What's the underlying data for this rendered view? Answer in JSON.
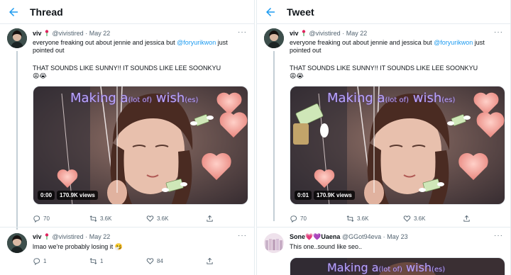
{
  "left": {
    "header_title": "Thread",
    "tweets": [
      {
        "name": "viv",
        "handle": "@vivistired",
        "sep": "·",
        "date": "May 22",
        "text_pre": "everyone freaking out about jennie and jessica but ",
        "mention": "@foryurikwon",
        "text_post": " just pointed out",
        "line2": "THAT SOUNDS LIKE SUNNY!! IT SOUNDS LIKE LEE SOONKYU",
        "emoji": "😩😭",
        "media": {
          "overlay_a": "Making a",
          "overlay_small": "(lot of)",
          "overlay_b": " wish",
          "overlay_small2": "(es)",
          "time": "0:00",
          "views": "170.9K views"
        },
        "stats": {
          "replies": "70",
          "retweets": "3.6K",
          "likes": "3.6K"
        }
      },
      {
        "name": "viv",
        "handle": "@vivistired",
        "sep": "·",
        "date": "May 22",
        "text": "lmao we're probably losing it 🤧",
        "stats": {
          "replies": "1",
          "retweets": "1",
          "likes": "84"
        }
      }
    ]
  },
  "right": {
    "header_title": "Tweet",
    "tweets": [
      {
        "name": "viv",
        "handle": "@vivistired",
        "sep": "·",
        "date": "May 22",
        "text_pre": "everyone freaking out about jennie and jessica but ",
        "mention": "@foryurikwon",
        "text_post": " just pointed out",
        "line2": "THAT SOUNDS LIKE SUNNY!! IT SOUNDS LIKE LEE SOONKYU",
        "emoji": "😩😭",
        "media": {
          "overlay_a": "Making a",
          "overlay_small": "(lot of)",
          "overlay_b": " wish",
          "overlay_small2": "(es)",
          "time": "0:01",
          "views": "170.9K views"
        },
        "stats": {
          "replies": "70",
          "retweets": "3.6K",
          "likes": "3.6K"
        }
      },
      {
        "name": "Sone💗💜Uaena",
        "handle": "@GGot94eva",
        "sep": "·",
        "date": "May 23",
        "text": "This one..sound like seo..",
        "media": {
          "overlay_a": "Making a",
          "overlay_small": "(lot of)",
          "overlay_b": " wish",
          "overlay_small2": "(es)"
        }
      }
    ]
  },
  "more_label": "···",
  "colors": {
    "link": "#1d9bf0",
    "muted": "#536471",
    "thread_line": "#c4cfd6",
    "overlay_text": "#b9a6ff"
  }
}
